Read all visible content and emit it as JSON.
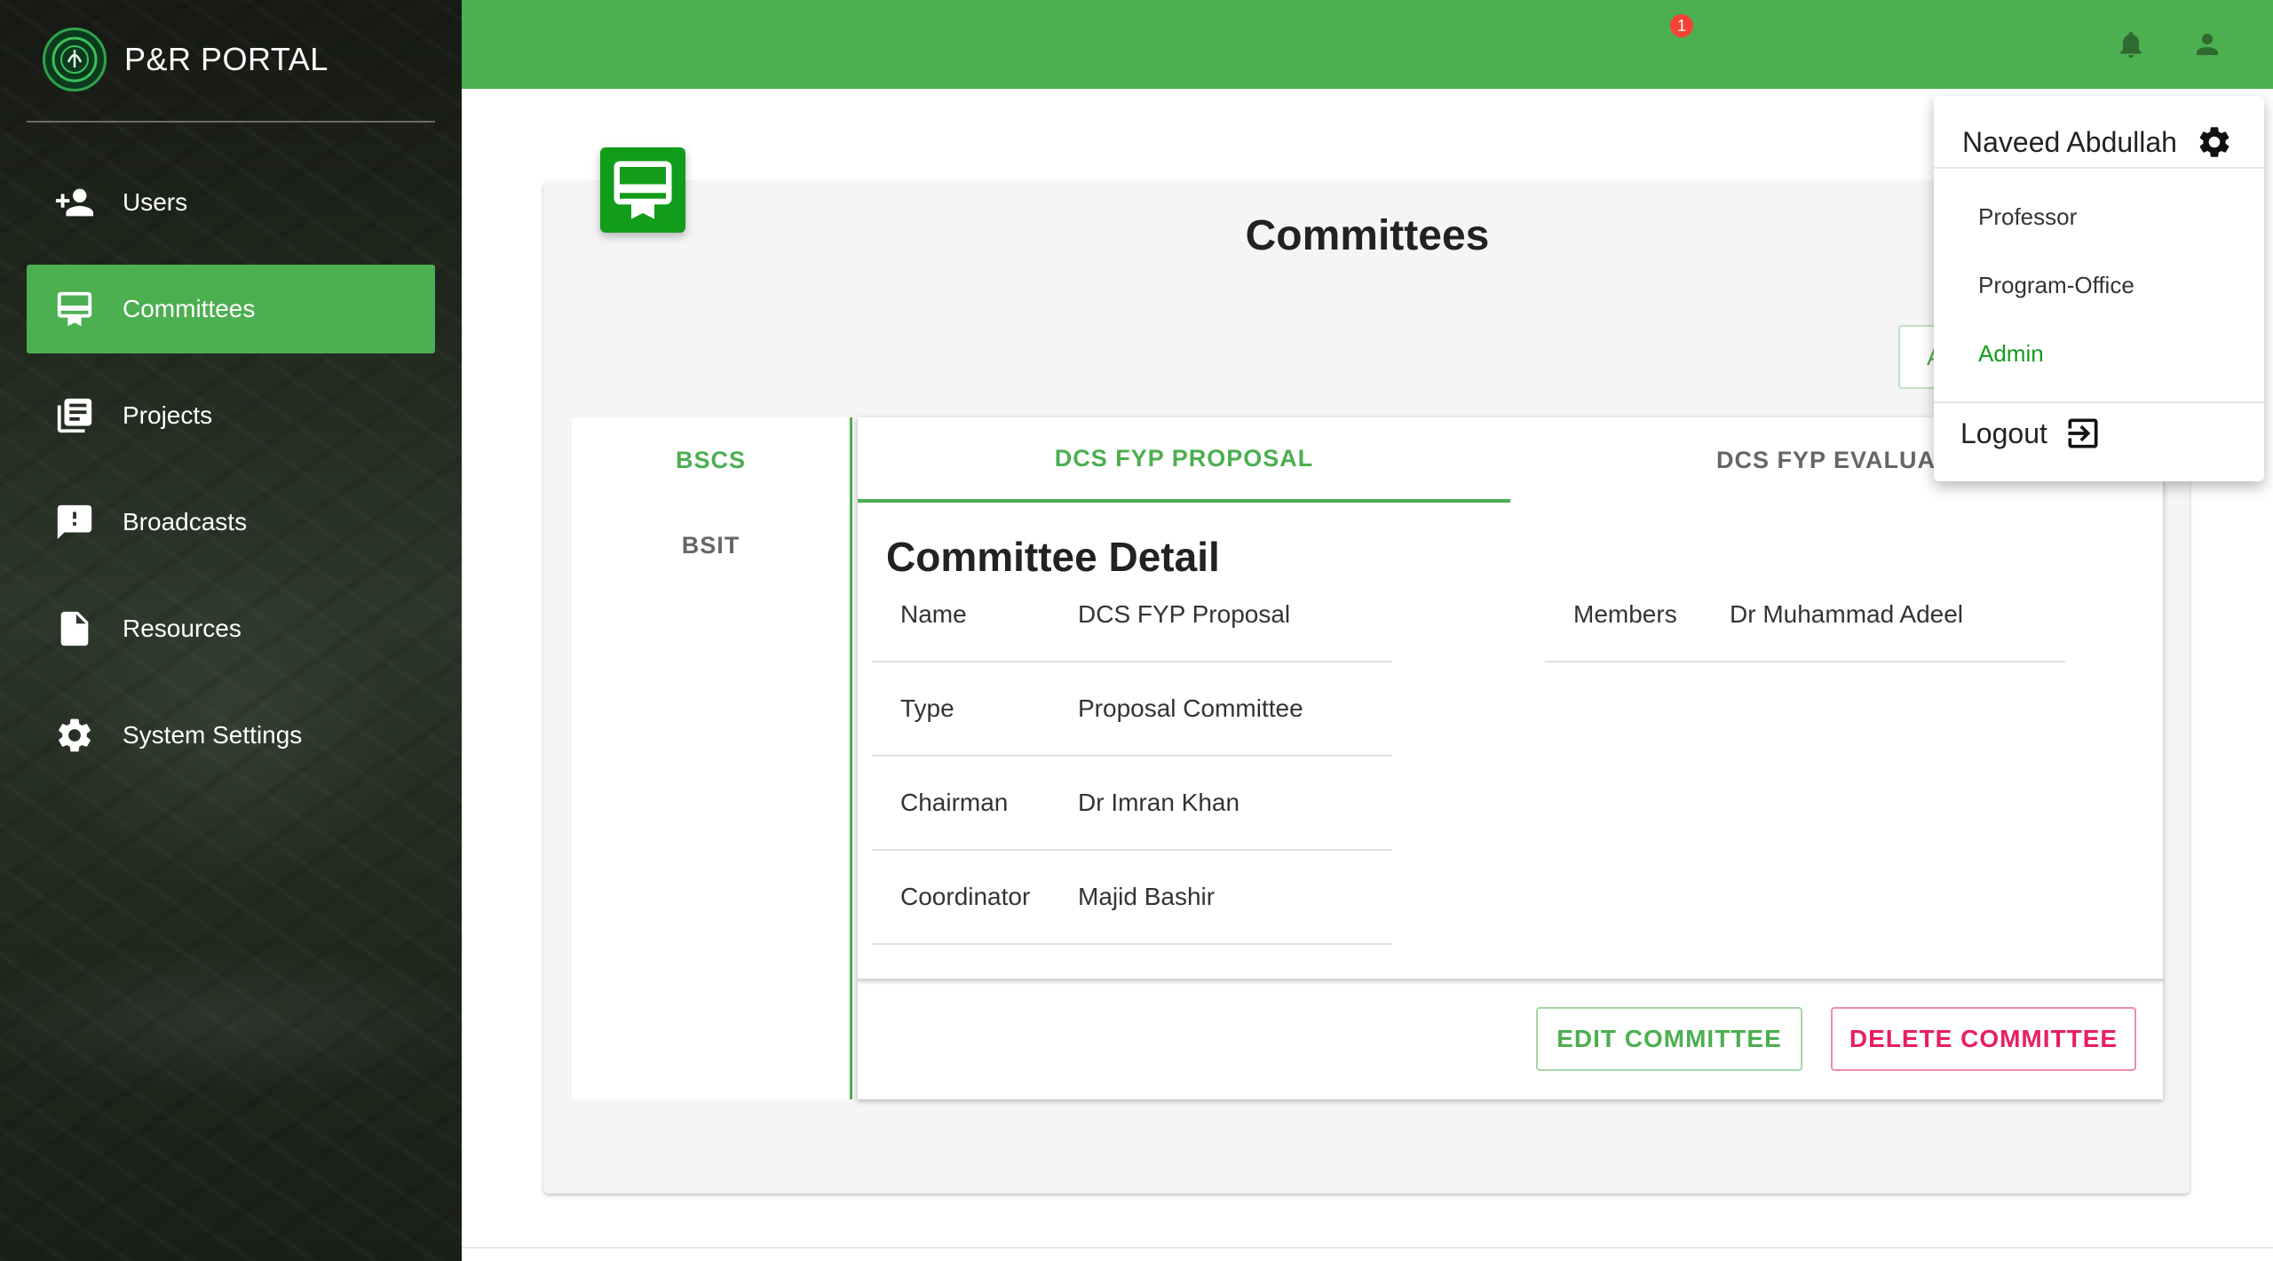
{
  "app": {
    "title": "P&R PORTAL"
  },
  "sidebar": {
    "items": [
      {
        "label": "Users",
        "icon": "add-user-icon",
        "active": false
      },
      {
        "label": "Committees",
        "icon": "card-membership-icon",
        "active": true
      },
      {
        "label": "Projects",
        "icon": "library-books-icon",
        "active": false
      },
      {
        "label": "Broadcasts",
        "icon": "feedback-icon",
        "active": false
      },
      {
        "label": "Resources",
        "icon": "file-icon",
        "active": false
      },
      {
        "label": "System Settings",
        "icon": "gear-icon",
        "active": false
      }
    ]
  },
  "topbar": {
    "notifications_count": "1",
    "bell_icon": "bell-icon",
    "account_icon": "person-icon"
  },
  "page": {
    "title": "Committees",
    "add_button_partial": "A"
  },
  "programs": {
    "tabs": [
      {
        "label": "BSCS",
        "active": true
      },
      {
        "label": "BSIT",
        "active": false
      }
    ]
  },
  "committee_tabs": [
    {
      "label": "DCS FYP PROPOSAL",
      "active": true
    },
    {
      "label": "DCS FYP EVALUATI",
      "active": false
    }
  ],
  "detail": {
    "title": "Committee Detail",
    "fields": [
      {
        "key": "Name",
        "value": "DCS FYP Proposal"
      },
      {
        "key": "Type",
        "value": "Proposal Committee"
      },
      {
        "key": "Chairman",
        "value": "Dr Imran Khan"
      },
      {
        "key": "Coordinator",
        "value": "Majid Bashir"
      }
    ],
    "members": [
      {
        "key": "Members",
        "value": "Dr Muhammad Adeel"
      }
    ]
  },
  "actions": {
    "edit_label": "EDIT COMMITTEE",
    "delete_label": "DELETE COMMITTEE"
  },
  "user_menu": {
    "user_name": "Naveed Abdullah",
    "roles": [
      {
        "label": "Professor",
        "active": false
      },
      {
        "label": "Program-Office",
        "active": false
      },
      {
        "label": "Admin",
        "active": true
      }
    ],
    "logout_label": "Logout"
  },
  "colors": {
    "primary": "#4caf50",
    "icon_green": "#119c1a",
    "danger": "#e91e63",
    "badge": "#f44336"
  }
}
